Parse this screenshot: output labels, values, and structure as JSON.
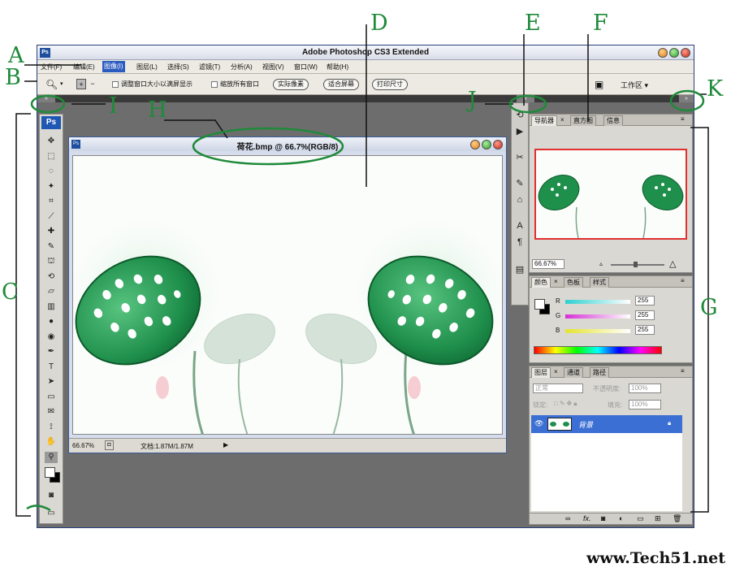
{
  "app": {
    "title": "Adobe Photoshop CS3 Extended",
    "logo": "Ps"
  },
  "menu": [
    {
      "label": "文件(F)"
    },
    {
      "label": "编辑(E)"
    },
    {
      "label": "图像(I)",
      "active": true
    },
    {
      "label": "图层(L)"
    },
    {
      "label": "选择(S)"
    },
    {
      "label": "滤镜(T)"
    },
    {
      "label": "分析(A)"
    },
    {
      "label": "视图(V)"
    },
    {
      "label": "窗口(W)"
    },
    {
      "label": "帮助(H)"
    }
  ],
  "options": {
    "resize_windows": "调整窗口大小以满屏显示",
    "zoom_all": "缩放所有窗口",
    "actual_pixels": "实际像素",
    "fit_screen": "适合屏幕",
    "print_size": "打印尺寸",
    "workspace": "工作区 ▾"
  },
  "strip": {
    "left_collapse": "»",
    "dock_collapse": "«",
    "right_collapse": "»"
  },
  "tools": {
    "logo": "Ps",
    "icons": [
      "move-icon",
      "marquee-icon",
      "lasso-icon",
      "magic-wand-icon",
      "crop-icon",
      "slice-icon",
      "healing-brush-icon",
      "brush-icon",
      "clone-stamp-icon",
      "history-brush-icon",
      "eraser-icon",
      "gradient-icon",
      "blur-icon",
      "dodge-icon",
      "pen-icon",
      "type-icon",
      "path-select-icon",
      "shape-icon",
      "notes-icon",
      "eyedropper-icon",
      "hand-icon",
      "zoom-icon"
    ]
  },
  "document": {
    "title": "荷花.bmp @ 66.7%(RGB/8)",
    "zoom": "66.67%",
    "doc_size": "文档:1.87M/1.87M"
  },
  "navigator": {
    "tabs": [
      "导航器",
      "直方图",
      "信息"
    ],
    "zoom": "66.67%"
  },
  "color_panel": {
    "tabs": [
      "颜色",
      "色板",
      "样式"
    ],
    "channels": [
      {
        "label": "R",
        "value": "255",
        "color": "#2fd0d0"
      },
      {
        "label": "G",
        "value": "255",
        "color": "#d630d6"
      },
      {
        "label": "B",
        "value": "255",
        "color": "#e4e430"
      }
    ]
  },
  "layers_panel": {
    "tabs": [
      "图层",
      "通道",
      "路径"
    ],
    "blend_mode": "正常",
    "opacity_label": "不透明度:",
    "opacity": "100%",
    "lock_label": "锁定:",
    "fill_label": "填充:",
    "fill": "100%",
    "layer_name": "背景",
    "footer_icons": [
      "link-icon",
      "fx-icon",
      "mask-icon",
      "adjustment-icon",
      "group-icon",
      "new-layer-icon",
      "trash-icon"
    ]
  },
  "annotations": [
    "A",
    "B",
    "C",
    "D",
    "E",
    "F",
    "G",
    "H",
    "I",
    "J",
    "K"
  ],
  "watermark": "www.Tech51.net",
  "colors": {
    "accent": "#2b5bbf",
    "annotation": "#1f8a3a",
    "selection_red": "#e03030"
  }
}
